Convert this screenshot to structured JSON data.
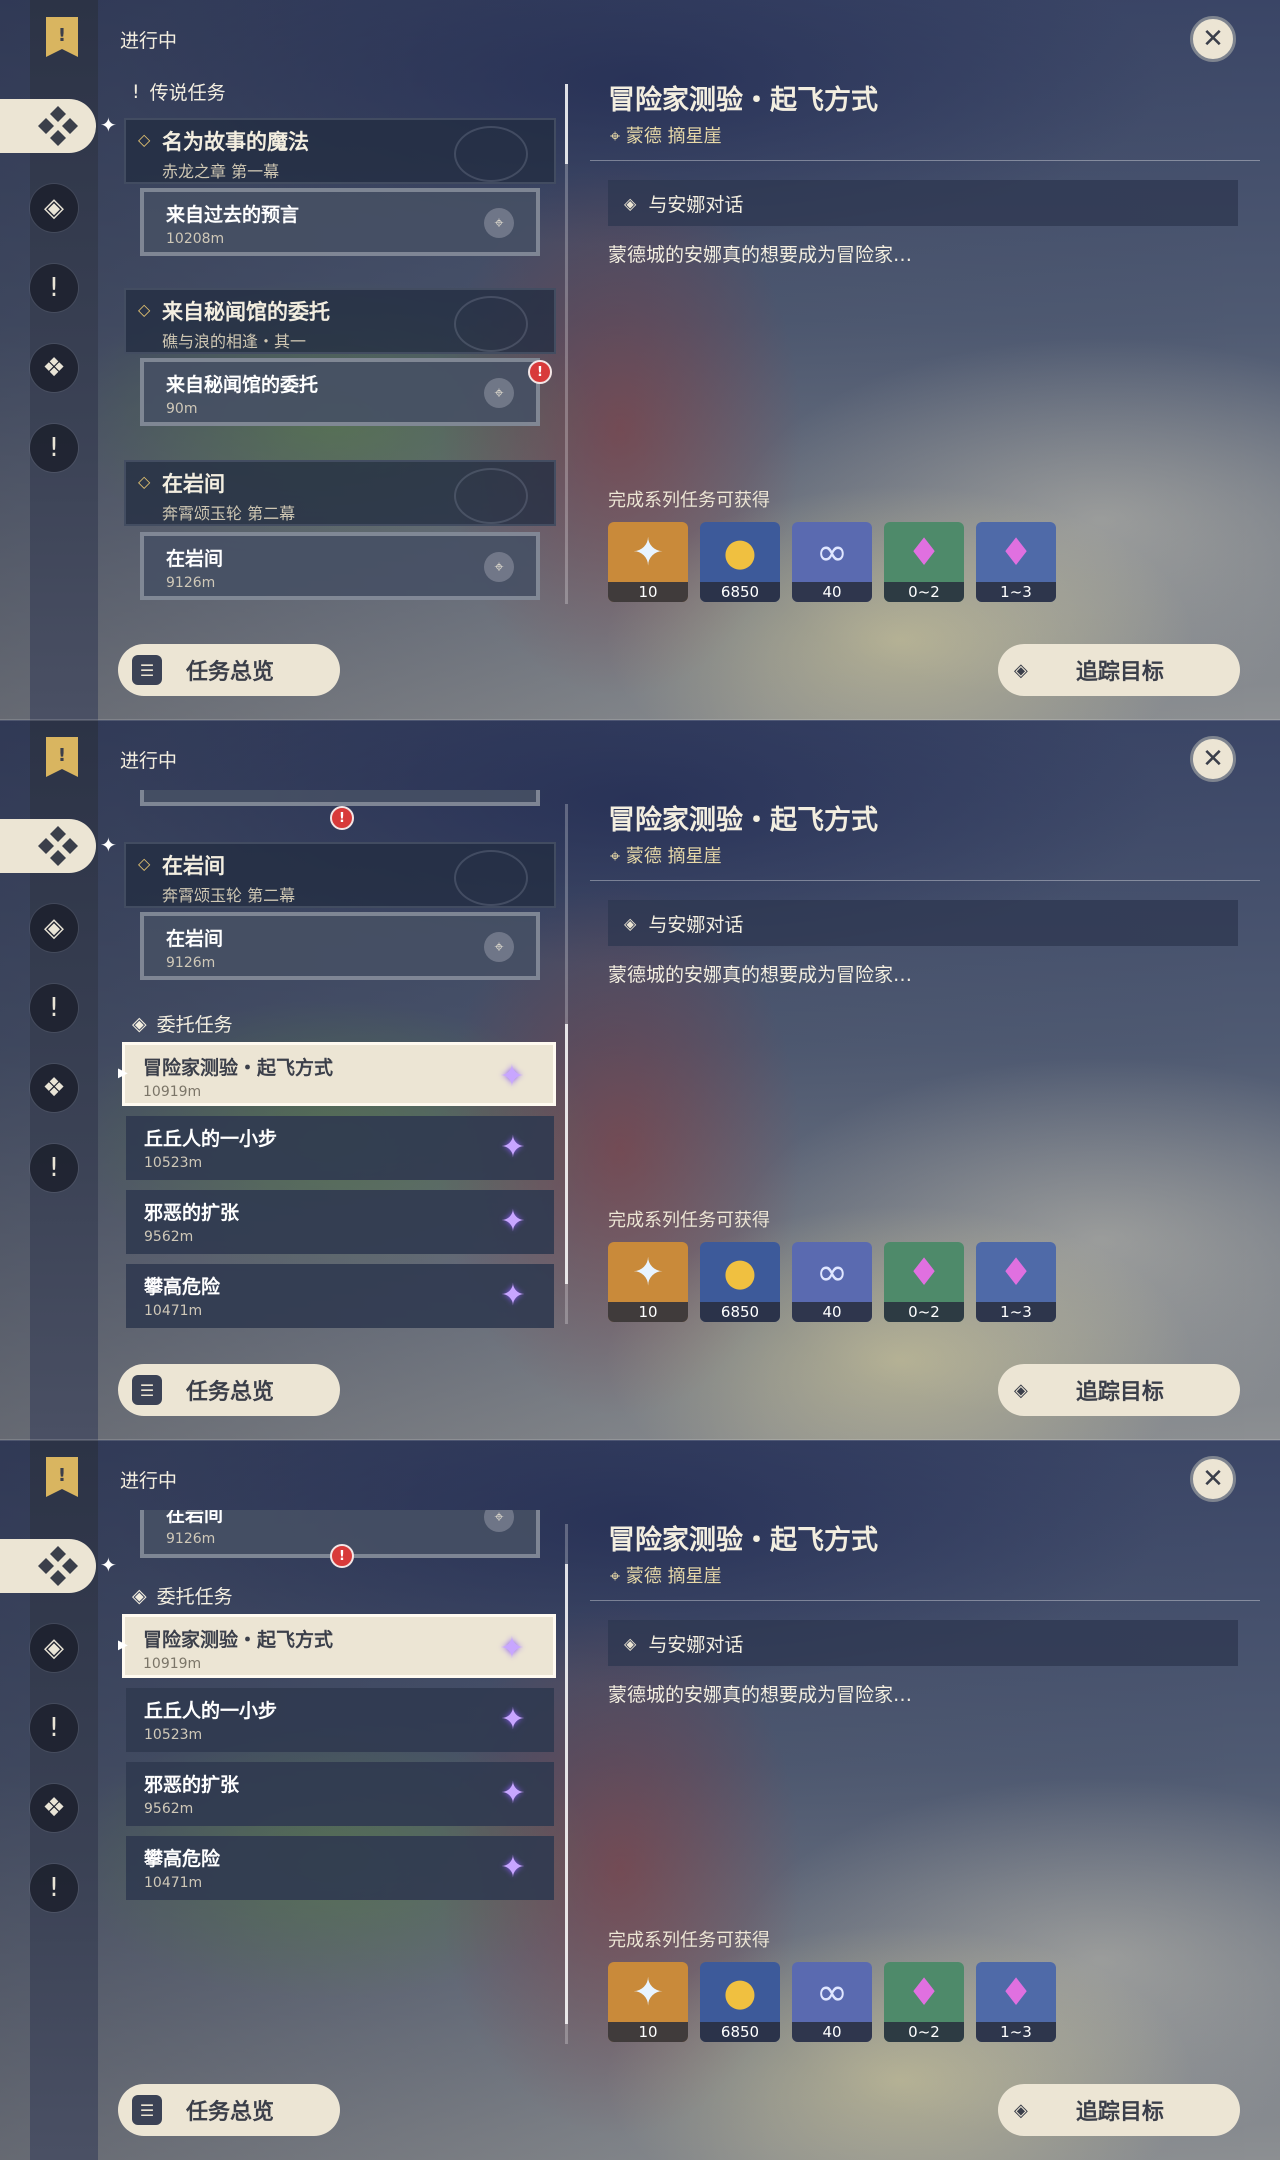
{
  "common": {
    "status_label": "进行中",
    "overview_label": "任务总览",
    "track_label": "追踪目标",
    "quest_title": "冒险家测验・起飞方式",
    "quest_location": "蒙德 摘星崖",
    "objective": "与安娜对话",
    "description": "蒙德城的安娜真的想要成为冒险家…",
    "rewards_label": "完成系列任务可获得",
    "rewards": [
      {
        "name": "primogem-icon",
        "count": "10",
        "color": "#c98a3a"
      },
      {
        "name": "mora-icon",
        "count": "6850",
        "color": "#3d5a9a"
      },
      {
        "name": "adventure-exp-icon",
        "count": "40",
        "color": "#5a6ab0"
      },
      {
        "name": "crystal-icon",
        "count": "0~2",
        "color": "#4e8a6a"
      },
      {
        "name": "crystal-chunk-icon",
        "count": "1~3",
        "color": "#4f6aa8"
      }
    ]
  },
  "panel1": {
    "legend_header": "传说任务",
    "groups": [
      {
        "title": "名为故事的魔法",
        "subtitle": "赤龙之章 第一幕",
        "sub_title": "来自过去的预言",
        "sub_dist": "10208m"
      },
      {
        "title": "来自秘闻馆的委托",
        "subtitle": "礁与浪的相逢・其一",
        "sub_title": "来自秘闻馆的委托",
        "sub_dist": "90m"
      },
      {
        "title": "在岩间",
        "subtitle": "奔霄颂玉轮 第二幕",
        "sub_title": "在岩间",
        "sub_dist": "9126m"
      }
    ]
  },
  "panel2": {
    "group": {
      "title": "在岩间",
      "subtitle": "奔霄颂玉轮 第二幕",
      "sub_title": "在岩间",
      "sub_dist": "9126m"
    },
    "commission_header": "委托任务",
    "commissions": [
      {
        "title": "冒险家测验・起飞方式",
        "dist": "10919m"
      },
      {
        "title": "丘丘人的一小步",
        "dist": "10523m"
      },
      {
        "title": "邪恶的扩张",
        "dist": "9562m"
      },
      {
        "title": "攀高危险",
        "dist": "10471m"
      }
    ]
  },
  "panel3": {
    "partial_title": "在岩间",
    "partial_dist": "9126m",
    "commission_header": "委托任务",
    "commissions": [
      {
        "title": "冒险家测验・起飞方式",
        "dist": "10919m"
      },
      {
        "title": "丘丘人的一小步",
        "dist": "10523m"
      },
      {
        "title": "邪恶的扩张",
        "dist": "9562m"
      },
      {
        "title": "攀高危险",
        "dist": "10471m"
      }
    ]
  }
}
